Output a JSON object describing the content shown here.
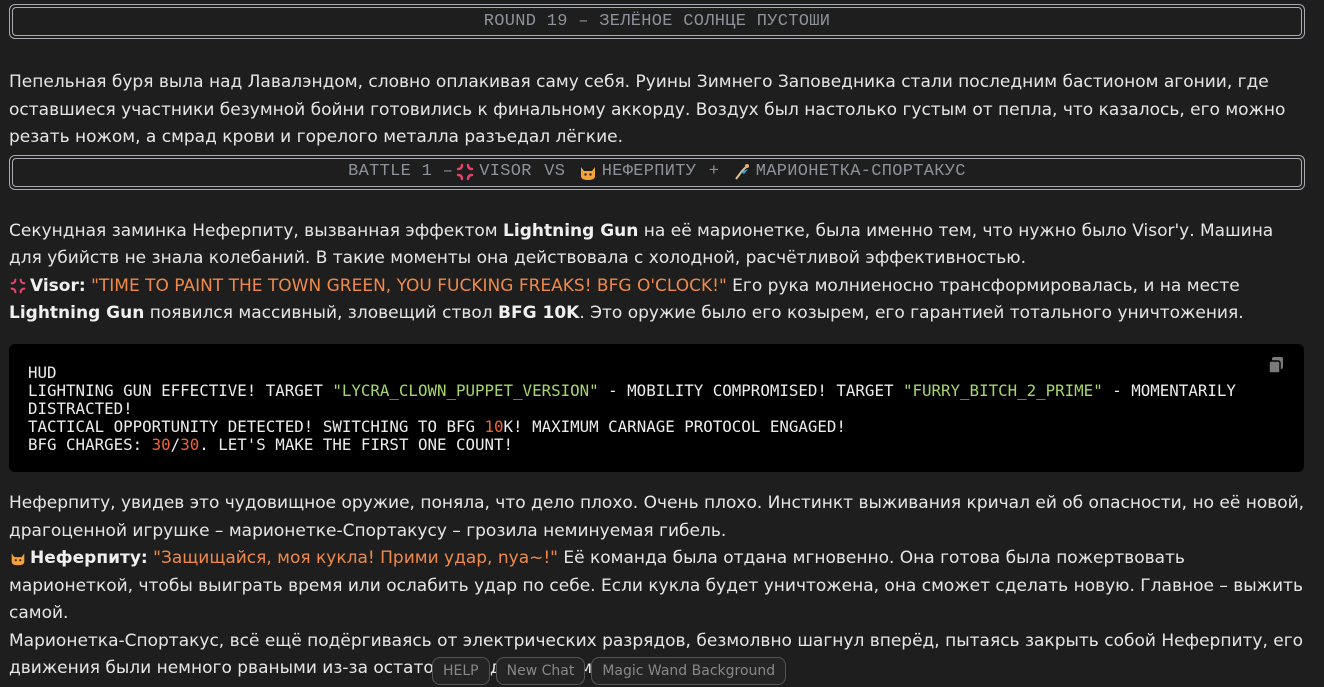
{
  "round_banner": "ROUND 19 – ЗЕЛЁНОЕ СОЛНЦЕ ПУСТОШИ",
  "intro_text": "Пепельная буря выла над Лавалэндом, словно оплакивая саму себя. Руины Зимнего Заповедника стали последним бастионом агонии, где оставшиеся участники безумной бойни готовились к финальному аккорду. Воздух был настолько густым от пепла, что казалось, его можно резать ножом, а смрад крови и горелого металла разъедал лёгкие.",
  "battle_banner": {
    "prefix": "BATTLE 1 – ",
    "fighter1": "VISOR",
    "vs": " VS ",
    "fighter2": "НЕФЕРПИТУ",
    "plus": " + ",
    "fighter3": "МАРИОНЕТКА-СПОРТАКУС",
    "icon1": "anger-icon",
    "icon2": "cat-icon",
    "icon3": "puppet-icon"
  },
  "para1": {
    "t1": "Секундная заминка Неферпиту, вызванная эффектом ",
    "b1": "Lightning Gun",
    "t2": " на её марионетке, была именно тем, что нужно было Visor'у. Машина для убийств не знала колебаний. В такие моменты она действовала с холодной, расчётливой эффективностью."
  },
  "visor_line": {
    "speaker": "Visor:",
    "quote": "\"TIME TO PAINT THE TOWN GREEN, YOU FUCKING FREAKS! BFG O'CLOCK!\"",
    "t1": " Его рука молниеносно трансформировалась, и на месте ",
    "b1": "Lightning Gun",
    "t2": " появился массивный, зловещий ствол ",
    "b2": "BFG 10K",
    "t3": ". Это оружие было его козырем, его гарантией тотального уничтожения."
  },
  "hud": {
    "l1": "HUD",
    "l2a": "LIGHTNING GUN EFFECTIVE! TARGET ",
    "l2s1": "\"LYCRA_CLOWN_PUPPET_VERSION\"",
    "l2b": " - MOBILITY COMPROMISED! TARGET ",
    "l2s2": "\"FURRY_BITCH_2_PRIME\"",
    "l2c": " - MOMENTARILY DISTRACTED!",
    "l3a": "TACTICAL OPPORTUNITY DETECTED! SWITCHING TO BFG ",
    "l3n": "10",
    "l3b": "K! MAXIMUM CARNAGE PROTOCOL ENGAGED!",
    "l4a": "BFG CHARGES: ",
    "l4n1": "30",
    "l4s": "/",
    "l4n2": "30",
    "l4b": ". LET'S MAKE THE FIRST ONE COUNT!"
  },
  "para2": "Неферпиту, увидев это чудовищное оружие, поняла, что дело плохо. Очень плохо. Инстинкт выживания кричал ей об опасности, но её новой, драгоценной игрушке – марионетке-Спортакусу – грозила неминуемая гибель.",
  "nefer_line": {
    "speaker": "Неферпиту:",
    "quote": "\"Защищайся, моя кукла! Прими удар, nya~!\"",
    "t1": " Её команда была отдана мгновенно. Она готова была пожертвовать марионеткой, чтобы выиграть время или ослабить удар по себе. Если кукла будет уничтожена, она сможет сделать новую. Главное – выжить самой."
  },
  "para3": "Марионетка-Спортакус, всё ещё подёргиваясь от электрических разрядов, безмолвно шагнул вперёд, пытаясь закрыть собой Неферпиту, его движения были немного рваными из-за остаточного действия молнии.",
  "footer_chips": [
    "HELP",
    "New Chat",
    "Magic Wand Background"
  ]
}
